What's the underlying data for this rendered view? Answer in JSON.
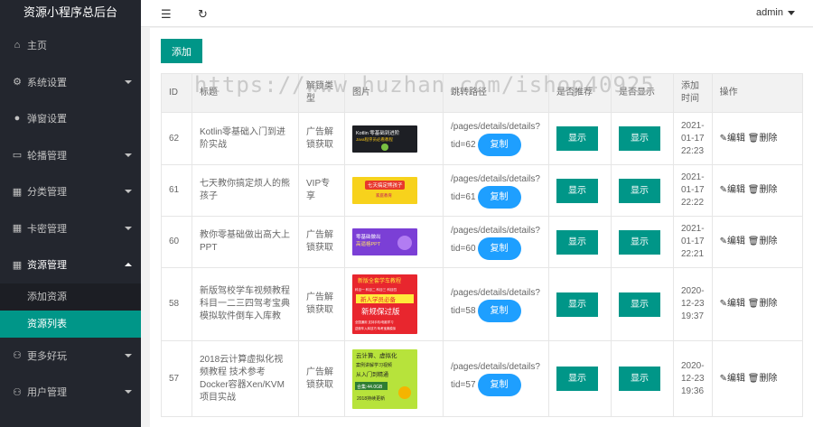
{
  "app_title": "资源小程序总后台",
  "header": {
    "user": "admin",
    "menu_icon": "menu-fold-icon",
    "refresh_icon": "refresh-icon"
  },
  "sidebar": {
    "items": [
      {
        "label": "主页",
        "icon": "home-icon"
      },
      {
        "label": "系统设置",
        "icon": "gear-icon"
      },
      {
        "label": "弹窗设置",
        "icon": "circle-icon"
      },
      {
        "label": "轮播管理",
        "icon": "carousel-icon"
      },
      {
        "label": "分类管理",
        "icon": "grid-icon"
      },
      {
        "label": "卡密管理",
        "icon": "grid-icon"
      },
      {
        "label": "资源管理",
        "icon": "grid-icon"
      },
      {
        "label": "更多好玩",
        "icon": "user-icon"
      },
      {
        "label": "用户管理",
        "icon": "user-icon"
      }
    ],
    "sub_items": [
      {
        "label": "添加资源"
      },
      {
        "label": "资源列表"
      }
    ]
  },
  "toolbar": {
    "add_label": "添加"
  },
  "table": {
    "headers": [
      "ID",
      "标题",
      "解锁类型",
      "图片",
      "跳转路径",
      "是否推荐",
      "是否显示",
      "添加时间",
      "操作"
    ],
    "rows": [
      {
        "id": "62",
        "title": "Kotlin零基础入门到进阶实战",
        "type": "广告解锁获取",
        "path": "/pages/details/details?tid=62",
        "recommend": "显示",
        "show": "显示",
        "time": "2021-01-17 22:23"
      },
      {
        "id": "61",
        "title": "七天教你搞定烦人的熊孩子",
        "type": "VIP专享",
        "path": "/pages/details/details?tid=61",
        "recommend": "显示",
        "show": "显示",
        "time": "2021-01-17 22:22"
      },
      {
        "id": "60",
        "title": "教你零基础做出高大上PPT",
        "type": "广告解锁获取",
        "path": "/pages/details/details?tid=60",
        "recommend": "显示",
        "show": "显示",
        "time": "2021-01-17 22:21"
      },
      {
        "id": "58",
        "title": "新版驾校学车视频教程 科目一二三四驾考宝典模拟软件倒车入库教",
        "type": "广告解锁获取",
        "path": "/pages/details/details?tid=58",
        "recommend": "显示",
        "show": "显示",
        "time": "2020-12-23 19:37"
      },
      {
        "id": "57",
        "title": "2018云计算虚拟化视频教程 技术参考Docker容器Xen/KVM项目实战",
        "type": "广告解锁获取",
        "path": "/pages/details/details?tid=57",
        "recommend": "显示",
        "show": "显示",
        "time": "2020-12-23 19:36"
      }
    ],
    "copy_label": "复制",
    "edit_label": "编辑",
    "delete_label": "删除"
  },
  "thumbnails": [
    {
      "lines": [
        "Kotlin 零基础到进阶",
        "Java程序员必看教程"
      ]
    },
    {
      "lines": [
        "七天搞定熊孩子",
        "家庭教育"
      ]
    },
    {
      "lines": [
        "零基础做出",
        "高逼格PPT"
      ]
    },
    {
      "lines": [
        "新版全套学车教程",
        "科目一 科目二 科目三 科目四",
        "新人学员必备",
        "新规保过版",
        "全国通用 支持手机/电脑学习",
        "送倒车入库技巧 驾考宝典模拟"
      ]
    },
    {
      "lines": [
        "云计算、虚拟化",
        "案例讲解学习视频",
        "从入门到精通",
        "合集:44.0GB",
        "2018持续更新"
      ]
    }
  ],
  "watermark": "https://www.huzhan.com/ishop40925",
  "colors": {
    "sidebar": "#23262e",
    "accent": "#009688",
    "copy": "#1e9fff"
  }
}
